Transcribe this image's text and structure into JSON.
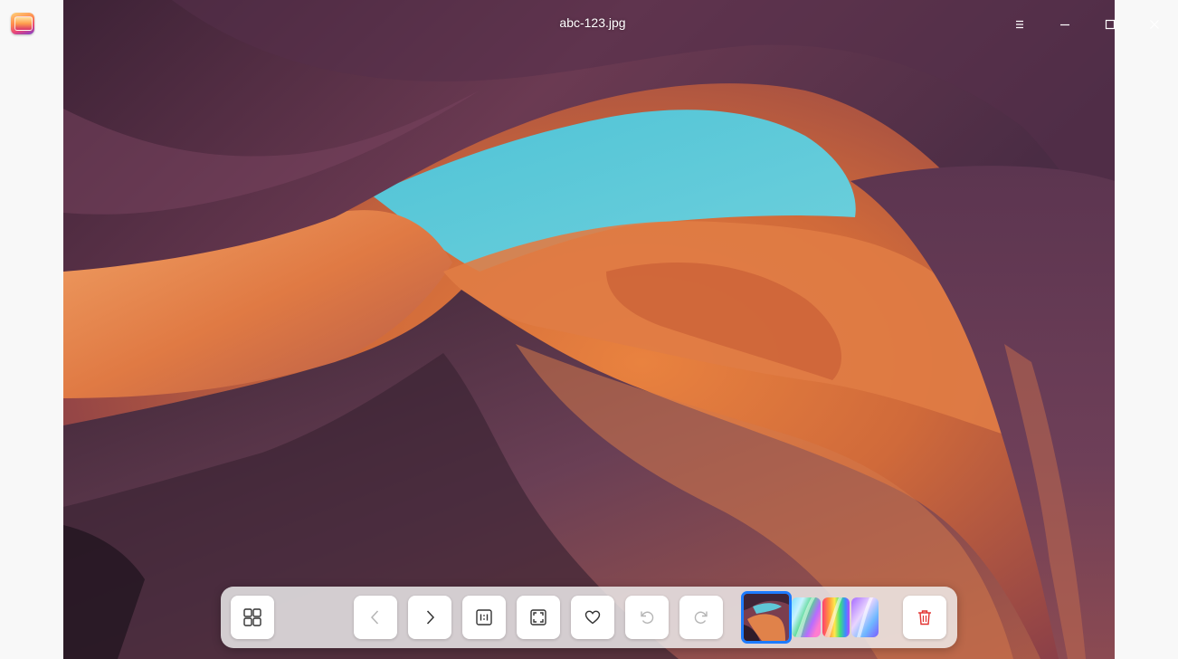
{
  "window": {
    "title": "abc-123.jpg"
  },
  "titlebar": {
    "app_icon": "image-viewer-app-icon",
    "controls": [
      "menu-icon",
      "minimize-icon",
      "maximize-icon",
      "close-icon"
    ]
  },
  "toolbar": {
    "buttons": [
      {
        "name": "thumbnail-view-button",
        "icon": "grid-icon",
        "enabled": true
      },
      {
        "name": "previous-button",
        "icon": "chevron-left-icon",
        "enabled": false
      },
      {
        "name": "next-button",
        "icon": "chevron-right-icon",
        "enabled": true
      },
      {
        "name": "original-size-button",
        "icon": "one-to-one-icon",
        "enabled": true
      },
      {
        "name": "fit-to-window-button",
        "icon": "fit-window-icon",
        "enabled": true
      },
      {
        "name": "favorite-button",
        "icon": "heart-icon",
        "enabled": true
      },
      {
        "name": "rotate-left-button",
        "icon": "rotate-ccw-icon",
        "enabled": false
      },
      {
        "name": "rotate-right-button",
        "icon": "rotate-cw-icon",
        "enabled": false
      },
      {
        "name": "delete-button",
        "icon": "trash-icon",
        "enabled": true
      }
    ],
    "thumbnails": [
      {
        "name": "thumbnail-canyon",
        "selected": true
      },
      {
        "name": "thumbnail-rainbow-1",
        "selected": false
      },
      {
        "name": "thumbnail-rainbow-2",
        "selected": false
      },
      {
        "name": "thumbnail-rainbow-3",
        "selected": false
      }
    ]
  },
  "colors": {
    "accent": "#1d7bff",
    "delete": "#e2312f",
    "icon": "#333333",
    "icon_disabled": "#b5b5b5"
  }
}
